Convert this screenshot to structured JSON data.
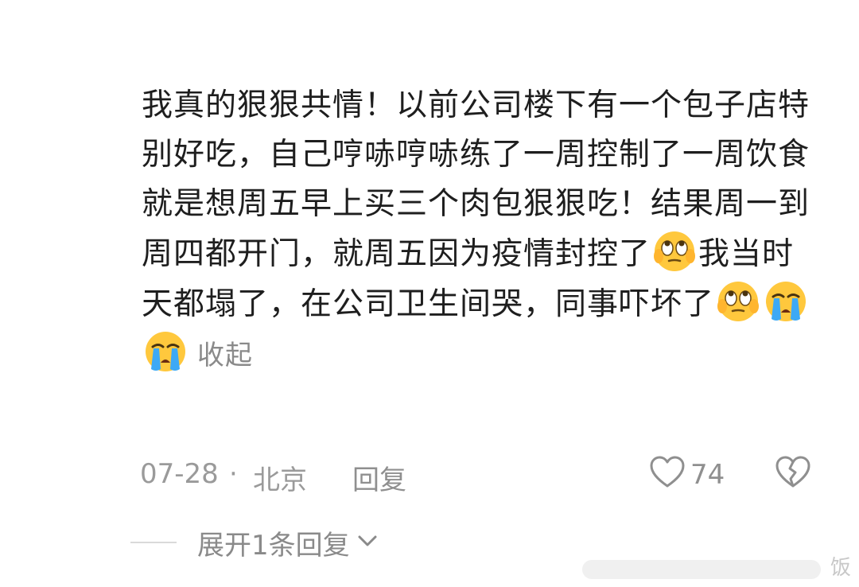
{
  "comment": {
    "text": "我真的狠狠共情！以前公司楼下有一个包子店特别好吃，自己哼哧哼哧练了一周控制了一周饮食 就是想周五早上买三个肉包狠狠吃！结果周一到周四都开门，就周五因为疫情封控了",
    "text_after_emoji_1": "我当时天都塌了，在公司卫生间哭，同事吓坏了",
    "collapse_label": "收起",
    "emojis": [
      "eye-roll-emoji",
      "eye-roll-emoji",
      "crying-emoji",
      "crying-emoji"
    ]
  },
  "meta": {
    "date": "07-28",
    "separator": "·",
    "location": "北京",
    "reply_label": "回复",
    "like_count": "74"
  },
  "expand": {
    "label": "展开1条回复"
  },
  "watermark": {
    "text": "饭"
  },
  "colors": {
    "text": "#1e1e1e",
    "muted": "#9a9a9a",
    "icon_stroke": "#8f8f8f",
    "emoji_yellow": "#ffc83d"
  },
  "icons": {
    "like": "heart-outline-icon",
    "dislike": "broken-heart-icon",
    "expand": "chevron-down-icon"
  }
}
